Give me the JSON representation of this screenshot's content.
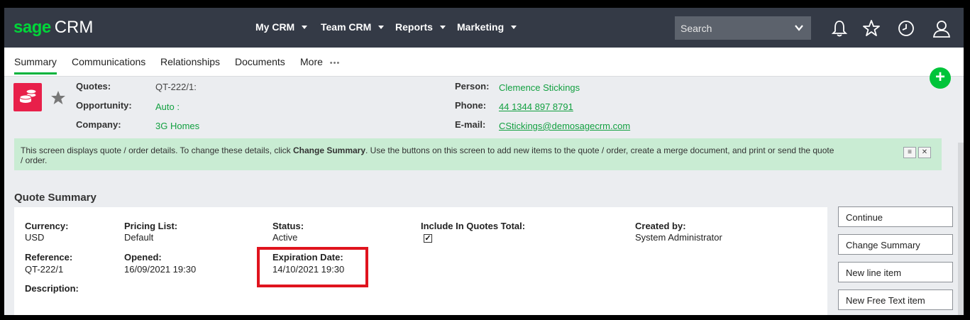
{
  "logo": {
    "brand": "sage",
    "product": "CRM"
  },
  "nav": {
    "menus": [
      "My CRM",
      "Team CRM",
      "Reports",
      "Marketing"
    ],
    "search_placeholder": "Search",
    "icons": [
      "bell-icon",
      "star-icon",
      "clock-icon",
      "user-icon"
    ]
  },
  "tabs": [
    "Summary",
    "Communications",
    "Relationships",
    "Documents",
    "More"
  ],
  "active_tab": "Summary",
  "header": {
    "quotes_label": "Quotes:",
    "quotes_value": "QT-222/1:",
    "opportunity_label": "Opportunity:",
    "opportunity_value": "Auto :",
    "company_label": "Company:",
    "company_value": "3G Homes",
    "person_label": "Person:",
    "person_value": "Clemence Stickings",
    "phone_label": "Phone:",
    "phone_value": "44 1344 897 8791",
    "email_label": "E-mail:",
    "email_value": "CStickings@demosagecrm.com"
  },
  "banner": {
    "text_before": "This screen displays quote / order details. To change these details, click ",
    "bold": "Change Summary",
    "text_after": ". Use the buttons on this screen to add new items to the quote / order, create a merge document, and print or send the quote / order."
  },
  "summary": {
    "title": "Quote Summary",
    "currency_label": "Currency:",
    "currency_value": "USD",
    "pricing_label": "Pricing List:",
    "pricing_value": "Default",
    "status_label": "Status:",
    "status_value": "Active",
    "include_label": "Include In Quotes Total:",
    "include_checked": true,
    "created_label": "Created by:",
    "created_value": "System Administrator",
    "reference_label": "Reference:",
    "reference_value": "QT-222/1",
    "opened_label": "Opened:",
    "opened_value": "16/09/2021 19:30",
    "expiration_label": "Expiration Date:",
    "expiration_value": "14/10/2021 19:30",
    "description_label": "Description:"
  },
  "actions": [
    "Continue",
    "Change Summary",
    "New line item",
    "New Free Text item"
  ],
  "colors": {
    "brand_green": "#00d639",
    "link_green": "#12a040",
    "topbar": "#343a46",
    "banner": "#c9ecd3",
    "highlight": "#e0141e",
    "quote_icon": "#e8204a"
  }
}
